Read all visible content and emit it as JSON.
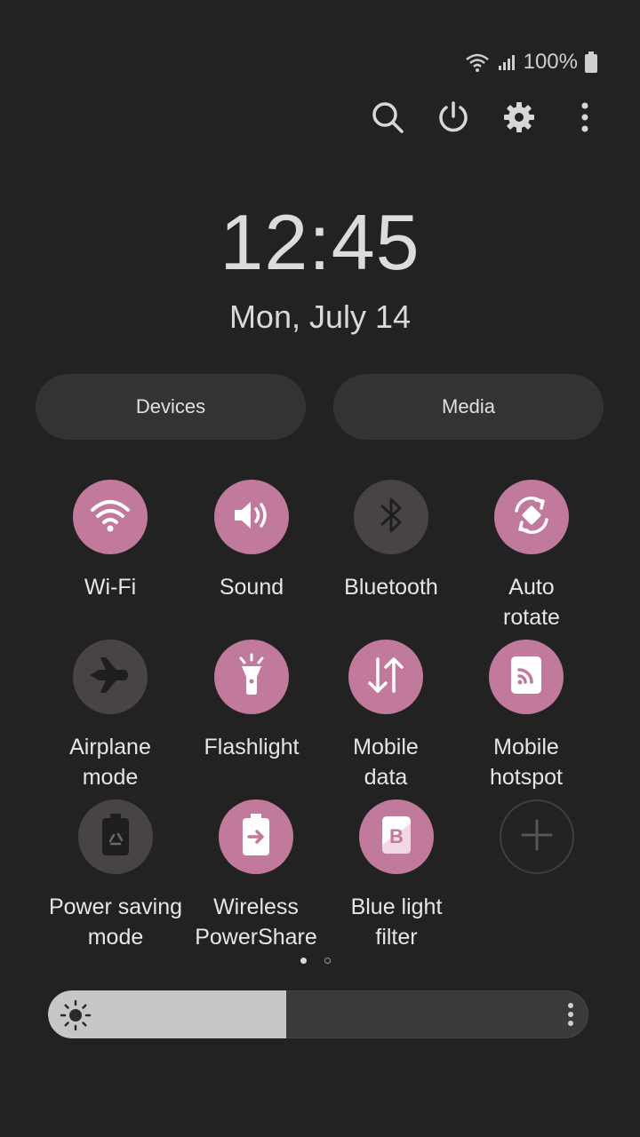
{
  "status_bar": {
    "battery_text": "100%",
    "icons": [
      "wifi-icon",
      "signal-icon",
      "battery-icon"
    ]
  },
  "top_actions": [
    "search-icon",
    "power-icon",
    "settings-icon",
    "more-vert-icon"
  ],
  "clock": {
    "time": "12:45",
    "date": "Mon, July 14"
  },
  "buttons": {
    "devices": "Devices",
    "media": "Media"
  },
  "tiles": [
    {
      "label": "Wi-Fi",
      "icon": "wifi-icon",
      "state": "on"
    },
    {
      "label": "Sound",
      "icon": "volume-icon",
      "state": "on"
    },
    {
      "label": "Bluetooth",
      "icon": "bluetooth-icon",
      "state": "off"
    },
    {
      "label": "Auto\nrotate",
      "icon": "auto-rotate-icon",
      "state": "on"
    },
    {
      "label": "Airplane\nmode",
      "icon": "airplane-icon",
      "state": "off"
    },
    {
      "label": "Flashlight",
      "icon": "flashlight-icon",
      "state": "on"
    },
    {
      "label": "Mobile\ndata",
      "icon": "mobile-data-icon",
      "state": "on"
    },
    {
      "label": "Mobile\nhotspot",
      "icon": "hotspot-icon",
      "state": "on"
    },
    {
      "label": "Power saving\nmode",
      "icon": "power-saving-icon",
      "state": "off"
    },
    {
      "label": "Wireless\nPowerShare",
      "icon": "powershare-icon",
      "state": "on"
    },
    {
      "label": "Blue light\nfilter",
      "icon": "blue-light-icon",
      "state": "on"
    },
    {
      "label": "",
      "icon": "add-icon",
      "state": "add"
    }
  ],
  "page_indicator": {
    "pages": 2,
    "current": 1
  },
  "brightness": {
    "level": 0.44
  },
  "colors": {
    "accent": "#c27a9c",
    "background": "#222222",
    "tile_off": "#484347"
  }
}
